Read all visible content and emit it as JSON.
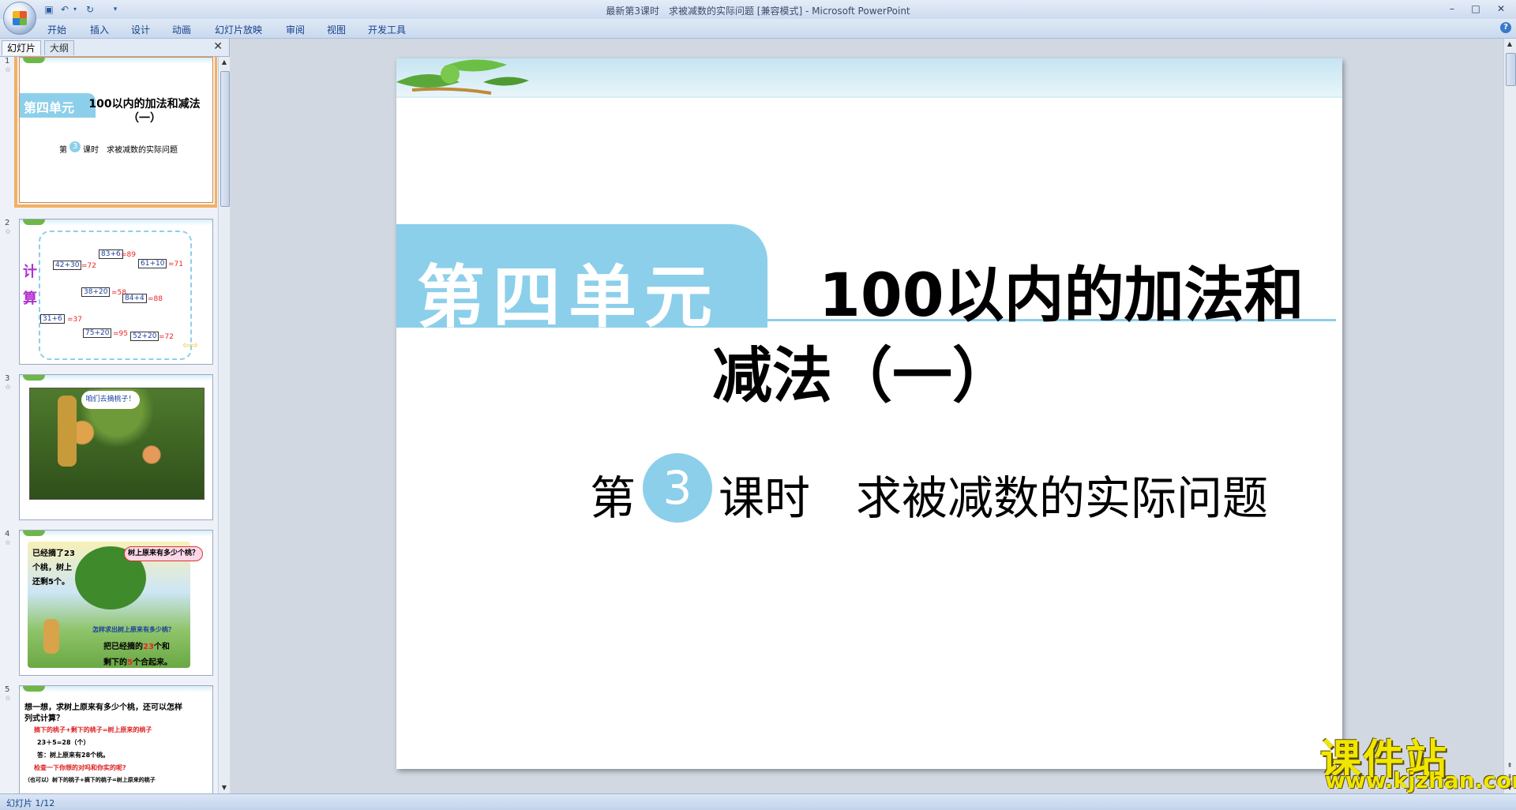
{
  "window": {
    "title": "最新第3课时　求被减数的实际问题 [兼容模式] - Microsoft PowerPoint",
    "controls": [
      "–",
      "□",
      "✕"
    ]
  },
  "ribbon": {
    "tabs": [
      "开始",
      "插入",
      "设计",
      "动画",
      "幻灯片放映",
      "审阅",
      "视图",
      "开发工具"
    ],
    "help": "?"
  },
  "pane": {
    "tab_slides": "幻灯片",
    "tab_outline": "大纲",
    "close": "✕"
  },
  "thumbnails": [
    {
      "number": "1",
      "unit": "第四单元",
      "title": "100以内的加法和减法（一）",
      "lesson_prefix": "第",
      "lesson_num": "3",
      "lesson_rest": "课时　求被减数的实际问题"
    },
    {
      "number": "2",
      "side_label_1": "计",
      "side_label_2": "算",
      "cards": [
        "42+30",
        "83+6",
        "61+10",
        "38+20",
        "84+4",
        "31+6",
        "75+20",
        "52+20"
      ],
      "answers": [
        "=72",
        "=89",
        "=71",
        "=58",
        "=88",
        "=37",
        "=95",
        "=72"
      ]
    },
    {
      "number": "3",
      "bubble": "咱们去摘桃子！"
    },
    {
      "number": "4",
      "text_left_1": "已经摘了23",
      "text_left_2": "个桃，树上",
      "text_left_3": "还剩5个。",
      "bubble": "树上原来有多少个桃？",
      "question": "怎样求出树上原来有多少桃？",
      "hint_1": "把已经摘的",
      "hint_num1": "23",
      "hint_2": "个和",
      "hint_3": "剩下的",
      "hint_num2": "5",
      "hint_4": "个合起来。"
    },
    {
      "number": "5",
      "line1": "想一想，求树上原来有多少个桃，还可以怎样",
      "line2": "列式计算？",
      "line3": "摘下的桃子+剩下的桃子=树上原来的桃子",
      "line4": "23＋5=28（个）",
      "line5": "答：树上原来有28个桃。",
      "line6": "检查一下你想的对吗和你实的呢?",
      "line7": "（也可以）树下的桃子+摘下的桃子=树上原来的桃子"
    }
  ],
  "slide": {
    "unit": "第四单元",
    "title_line1": "100以内的加法和",
    "title_line2": "减法（一）",
    "lesson_prefix": "第",
    "lesson_num": "3",
    "lesson_rest": "课时　求被减数的实际问题"
  },
  "watermark": {
    "cn": "课件站",
    "url": "www.kjzhan.com"
  },
  "status": {
    "slide_counter": "幻灯片 1/12"
  },
  "colors": {
    "accent": "#8ccfea",
    "ribbon_text": "#15428b",
    "watermark": "#f1e600",
    "selection": "#f2b062"
  }
}
